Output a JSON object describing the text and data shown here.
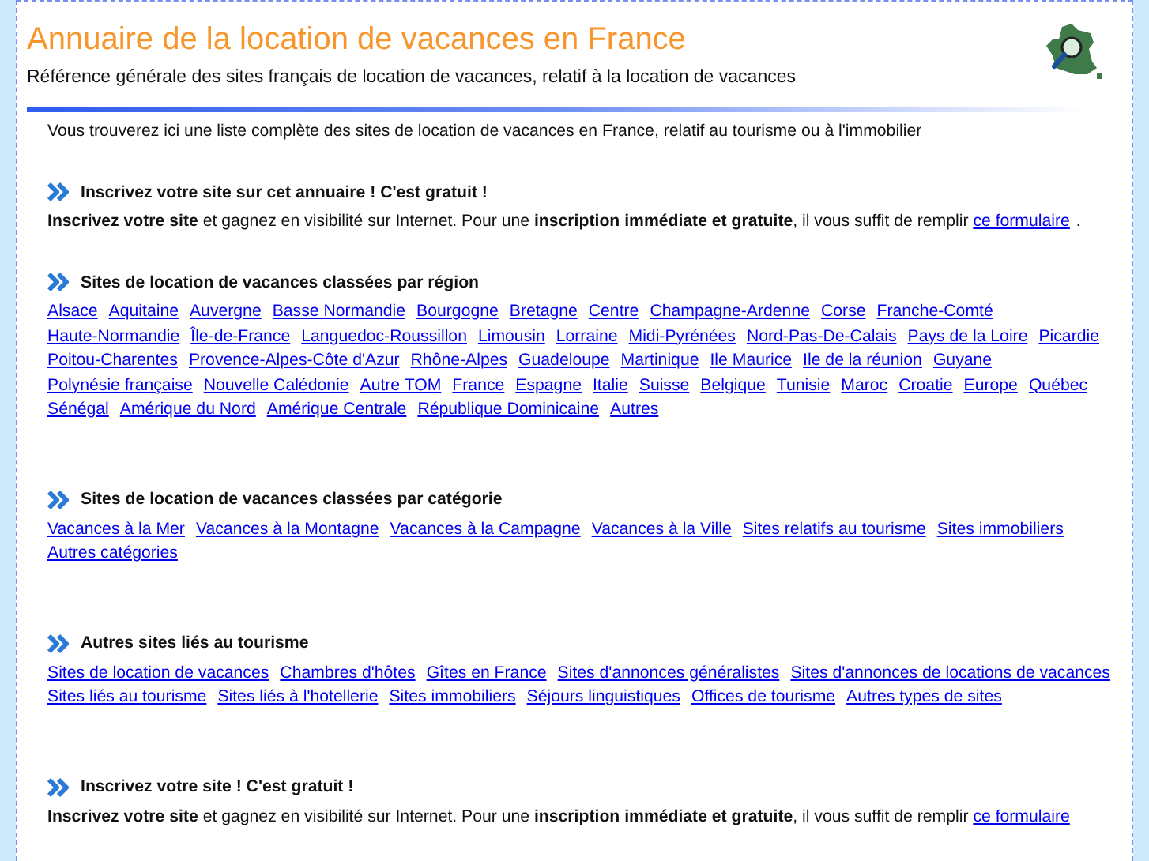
{
  "header": {
    "title": "Annuaire de la location de vacances en France",
    "subtitle": "Référence générale des sites français de location de vacances, relatif à la location de vacances"
  },
  "intro": "Vous trouverez ici une liste complète des sites de location de vacances en France, relatif au tourisme ou à l'immobilier",
  "sections": [
    {
      "kind": "signup",
      "heading": "Inscrivez votre site sur cet annuaire ! C'est gratuit !",
      "text": "**Inscrivez votre site** et gagnez en visibilité sur Internet. Pour une **inscription immédiate et gratuite**, il vous suffit de remplir",
      "link": "ce formulaire",
      "after": "."
    },
    {
      "kind": "links",
      "heading": "Sites de location de vacances classées par région",
      "links": [
        "Alsace",
        "Aquitaine",
        "Auvergne",
        "Basse Normandie",
        "Bourgogne",
        "Bretagne",
        "Centre",
        "Champagne-Ardenne",
        "Corse",
        "Franche-Comté",
        "Haute-Normandie",
        "Île-de-France",
        "Languedoc-Roussillon",
        "Limousin",
        "Lorraine",
        "Midi-Pyrénées",
        "Nord-Pas-De-Calais",
        "Pays de la Loire",
        "Picardie",
        "Poitou-Charentes",
        "Provence-Alpes-Côte d'Azur",
        "Rhône-Alpes",
        "Guadeloupe",
        "Martinique",
        "Ile Maurice",
        "Ile de la réunion",
        "Guyane",
        "Polynésie française",
        "Nouvelle Calédonie",
        "Autre TOM",
        "France",
        "Espagne",
        "Italie",
        "Suisse",
        "Belgique",
        "Tunisie",
        "Maroc",
        "Croatie",
        "Europe",
        "Québec",
        "Sénégal",
        "Amérique du Nord",
        "Amérique Centrale",
        "République Dominicaine",
        "Autres"
      ]
    },
    {
      "kind": "links",
      "heading": "Sites de location de vacances classées par catégorie",
      "links": [
        "Vacances à la Mer",
        "Vacances à la Montagne",
        "Vacances à la Campagne",
        "Vacances à la Ville",
        "Sites relatifs au tourisme",
        "Sites immobiliers",
        "Autres catégories"
      ]
    },
    {
      "kind": "links",
      "heading": "Autres sites liés au tourisme",
      "links": [
        "Sites de location de vacances",
        "Chambres d'hôtes",
        "Gîtes en France",
        "Sites d'annonces généralistes",
        "Sites d'annonces de locations de vacances",
        "Sites liés au tourisme",
        "Sites liés à l'hotellerie",
        "Sites immobiliers",
        "Séjours linguistiques",
        "Offices de tourisme",
        "Autres types de sites"
      ]
    },
    {
      "kind": "signup",
      "heading": "Inscrivez votre site ! C'est gratuit !",
      "text": "**Inscrivez votre site** et gagnez en visibilité sur Internet. Pour une **inscription immédiate et gratuite**, il vous suffit de remplir",
      "link": "ce formulaire"
    }
  ]
}
